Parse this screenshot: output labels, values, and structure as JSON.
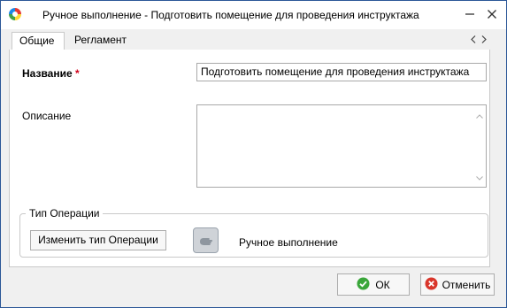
{
  "window": {
    "title": "Ручное выполнение - Подготовить помещение для проведения инструктажа"
  },
  "tabs": [
    {
      "label": "Общие"
    },
    {
      "label": "Регламент"
    }
  ],
  "form": {
    "name_label": "Название",
    "required_mark": "*",
    "name_value": "Подготовить помещение для проведения инструктажа",
    "description_label": "Описание",
    "description_value": ""
  },
  "operation_group": {
    "title": "Тип Операции",
    "change_button": "Изменить тип Операции",
    "operation_label": "Ручное выполнение",
    "operation_icon": "hand-icon"
  },
  "footer": {
    "ok_label": "ОК",
    "cancel_label": "Отменить"
  },
  "colors": {
    "ok_green": "#3aa63a",
    "cancel_red": "#d9362b",
    "required_red": "#d0021b"
  }
}
